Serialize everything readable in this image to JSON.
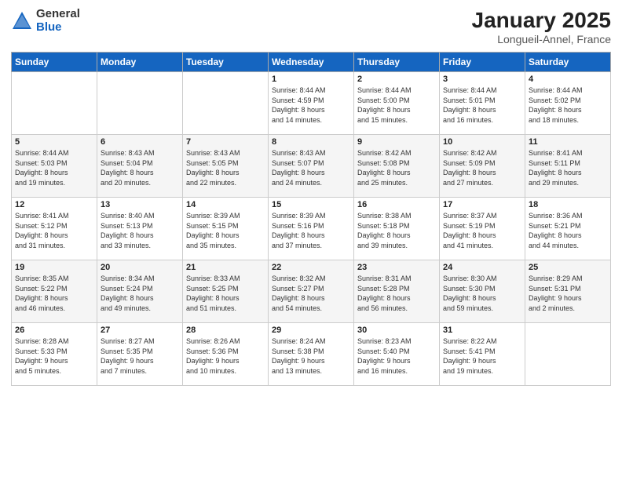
{
  "logo": {
    "general": "General",
    "blue": "Blue"
  },
  "title": "January 2025",
  "subtitle": "Longueil-Annel, France",
  "days_header": [
    "Sunday",
    "Monday",
    "Tuesday",
    "Wednesday",
    "Thursday",
    "Friday",
    "Saturday"
  ],
  "weeks": [
    [
      {
        "day": "",
        "info": ""
      },
      {
        "day": "",
        "info": ""
      },
      {
        "day": "",
        "info": ""
      },
      {
        "day": "1",
        "info": "Sunrise: 8:44 AM\nSunset: 4:59 PM\nDaylight: 8 hours\nand 14 minutes."
      },
      {
        "day": "2",
        "info": "Sunrise: 8:44 AM\nSunset: 5:00 PM\nDaylight: 8 hours\nand 15 minutes."
      },
      {
        "day": "3",
        "info": "Sunrise: 8:44 AM\nSunset: 5:01 PM\nDaylight: 8 hours\nand 16 minutes."
      },
      {
        "day": "4",
        "info": "Sunrise: 8:44 AM\nSunset: 5:02 PM\nDaylight: 8 hours\nand 18 minutes."
      }
    ],
    [
      {
        "day": "5",
        "info": "Sunrise: 8:44 AM\nSunset: 5:03 PM\nDaylight: 8 hours\nand 19 minutes."
      },
      {
        "day": "6",
        "info": "Sunrise: 8:43 AM\nSunset: 5:04 PM\nDaylight: 8 hours\nand 20 minutes."
      },
      {
        "day": "7",
        "info": "Sunrise: 8:43 AM\nSunset: 5:05 PM\nDaylight: 8 hours\nand 22 minutes."
      },
      {
        "day": "8",
        "info": "Sunrise: 8:43 AM\nSunset: 5:07 PM\nDaylight: 8 hours\nand 24 minutes."
      },
      {
        "day": "9",
        "info": "Sunrise: 8:42 AM\nSunset: 5:08 PM\nDaylight: 8 hours\nand 25 minutes."
      },
      {
        "day": "10",
        "info": "Sunrise: 8:42 AM\nSunset: 5:09 PM\nDaylight: 8 hours\nand 27 minutes."
      },
      {
        "day": "11",
        "info": "Sunrise: 8:41 AM\nSunset: 5:11 PM\nDaylight: 8 hours\nand 29 minutes."
      }
    ],
    [
      {
        "day": "12",
        "info": "Sunrise: 8:41 AM\nSunset: 5:12 PM\nDaylight: 8 hours\nand 31 minutes."
      },
      {
        "day": "13",
        "info": "Sunrise: 8:40 AM\nSunset: 5:13 PM\nDaylight: 8 hours\nand 33 minutes."
      },
      {
        "day": "14",
        "info": "Sunrise: 8:39 AM\nSunset: 5:15 PM\nDaylight: 8 hours\nand 35 minutes."
      },
      {
        "day": "15",
        "info": "Sunrise: 8:39 AM\nSunset: 5:16 PM\nDaylight: 8 hours\nand 37 minutes."
      },
      {
        "day": "16",
        "info": "Sunrise: 8:38 AM\nSunset: 5:18 PM\nDaylight: 8 hours\nand 39 minutes."
      },
      {
        "day": "17",
        "info": "Sunrise: 8:37 AM\nSunset: 5:19 PM\nDaylight: 8 hours\nand 41 minutes."
      },
      {
        "day": "18",
        "info": "Sunrise: 8:36 AM\nSunset: 5:21 PM\nDaylight: 8 hours\nand 44 minutes."
      }
    ],
    [
      {
        "day": "19",
        "info": "Sunrise: 8:35 AM\nSunset: 5:22 PM\nDaylight: 8 hours\nand 46 minutes."
      },
      {
        "day": "20",
        "info": "Sunrise: 8:34 AM\nSunset: 5:24 PM\nDaylight: 8 hours\nand 49 minutes."
      },
      {
        "day": "21",
        "info": "Sunrise: 8:33 AM\nSunset: 5:25 PM\nDaylight: 8 hours\nand 51 minutes."
      },
      {
        "day": "22",
        "info": "Sunrise: 8:32 AM\nSunset: 5:27 PM\nDaylight: 8 hours\nand 54 minutes."
      },
      {
        "day": "23",
        "info": "Sunrise: 8:31 AM\nSunset: 5:28 PM\nDaylight: 8 hours\nand 56 minutes."
      },
      {
        "day": "24",
        "info": "Sunrise: 8:30 AM\nSunset: 5:30 PM\nDaylight: 8 hours\nand 59 minutes."
      },
      {
        "day": "25",
        "info": "Sunrise: 8:29 AM\nSunset: 5:31 PM\nDaylight: 9 hours\nand 2 minutes."
      }
    ],
    [
      {
        "day": "26",
        "info": "Sunrise: 8:28 AM\nSunset: 5:33 PM\nDaylight: 9 hours\nand 5 minutes."
      },
      {
        "day": "27",
        "info": "Sunrise: 8:27 AM\nSunset: 5:35 PM\nDaylight: 9 hours\nand 7 minutes."
      },
      {
        "day": "28",
        "info": "Sunrise: 8:26 AM\nSunset: 5:36 PM\nDaylight: 9 hours\nand 10 minutes."
      },
      {
        "day": "29",
        "info": "Sunrise: 8:24 AM\nSunset: 5:38 PM\nDaylight: 9 hours\nand 13 minutes."
      },
      {
        "day": "30",
        "info": "Sunrise: 8:23 AM\nSunset: 5:40 PM\nDaylight: 9 hours\nand 16 minutes."
      },
      {
        "day": "31",
        "info": "Sunrise: 8:22 AM\nSunset: 5:41 PM\nDaylight: 9 hours\nand 19 minutes."
      },
      {
        "day": "",
        "info": ""
      }
    ]
  ]
}
